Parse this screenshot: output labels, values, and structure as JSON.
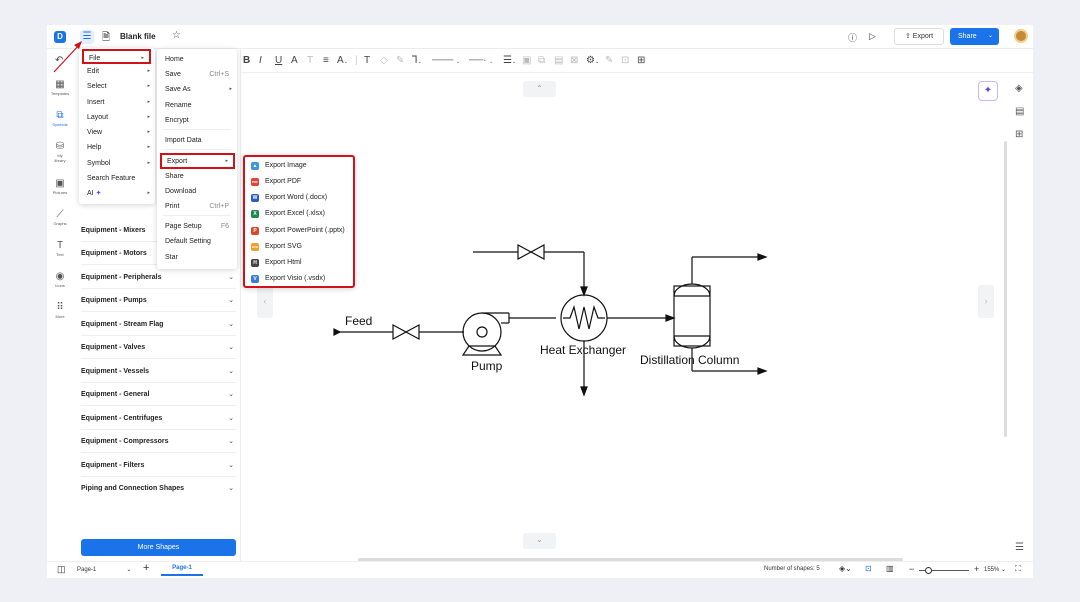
{
  "topbar": {
    "logo_letter": "D",
    "hamburger": "☰",
    "file_title": "Blank file",
    "export_label": "Export",
    "share_label": "Share"
  },
  "rail": [
    {
      "name": "rail-templates",
      "icon": "▦",
      "label": "Templates"
    },
    {
      "name": "rail-symbols",
      "icon": "⧉",
      "label": "Symbols"
    },
    {
      "name": "rail-my-library",
      "icon": "⛁",
      "label": "My library"
    },
    {
      "name": "rail-pictures",
      "icon": "▣",
      "label": "Pictures"
    },
    {
      "name": "rail-graphs",
      "icon": "⟋",
      "label": "Graphs"
    },
    {
      "name": "rail-text",
      "icon": "T",
      "label": "Text"
    },
    {
      "name": "rail-icons",
      "icon": "◉",
      "label": "Icons"
    },
    {
      "name": "rail-more",
      "icon": "⠿",
      "label": "More"
    }
  ],
  "categories": [
    "Equipment - Mixers",
    "Equipment - Motors",
    "Equipment - Peripherals",
    "Equipment - Pumps",
    "Equipment - Stream Flag",
    "Equipment - Valves",
    "Equipment - Vessels",
    "Equipment - General",
    "Equipment - Centrifuges",
    "Equipment - Compressors",
    "Equipment - Filters",
    "Piping and Connection Shapes"
  ],
  "more_shapes": "More Shapes",
  "main_menu": [
    {
      "label": "File",
      "arrow": true
    },
    {
      "label": "Edit",
      "arrow": true
    },
    {
      "label": "Select",
      "arrow": true
    },
    {
      "label": "Insert",
      "arrow": true
    },
    {
      "label": "Layout",
      "arrow": true
    },
    {
      "label": "View",
      "arrow": true
    },
    {
      "label": "Help",
      "arrow": true
    },
    {
      "label": "Symbol",
      "arrow": true
    },
    {
      "label": "Search Feature",
      "arrow": false
    },
    {
      "label": "AI",
      "arrow": true
    }
  ],
  "file_menu": [
    {
      "label": "Home",
      "shortcut": ""
    },
    {
      "label": "Save",
      "shortcut": "Ctrl+S"
    },
    {
      "label": "Save As",
      "shortcut": "▸"
    },
    {
      "label": "Rename",
      "shortcut": ""
    },
    {
      "label": "Encrypt",
      "shortcut": ""
    },
    {
      "label": "Import Data",
      "shortcut": ""
    },
    {
      "label": "Export",
      "shortcut": "▸"
    },
    {
      "label": "Share",
      "shortcut": ""
    },
    {
      "label": "Download",
      "shortcut": ""
    },
    {
      "label": "Print",
      "shortcut": "Ctrl+P"
    },
    {
      "label": "Page Setup",
      "shortcut": "F6"
    },
    {
      "label": "Default Setting",
      "shortcut": ""
    },
    {
      "label": "Star",
      "shortcut": ""
    }
  ],
  "export_menu": [
    {
      "label": "Export Image",
      "badge": "▲",
      "color": "#3a9ad9"
    },
    {
      "label": "Export PDF",
      "badge": "PDF",
      "color": "#e0443a"
    },
    {
      "label": "Export Word (.docx)",
      "badge": "W",
      "color": "#2b5cb8"
    },
    {
      "label": "Export Excel (.xlsx)",
      "badge": "X",
      "color": "#1e8a4a"
    },
    {
      "label": "Export PowerPoint (.pptx)",
      "badge": "P",
      "color": "#d9472b"
    },
    {
      "label": "Export SVG",
      "badge": "SVG",
      "color": "#f0a030"
    },
    {
      "label": "Export Html",
      "badge": "H",
      "color": "#444444"
    },
    {
      "label": "Export Visio (.vsdx)",
      "badge": "V",
      "color": "#3b7bd9"
    }
  ],
  "diagram": {
    "feed": "Feed",
    "pump": "Pump",
    "heat_exchanger": "Heat Exchanger",
    "distillation_column": "Distillation Column"
  },
  "bottom": {
    "page_select": "Page-1",
    "page_tab": "Page-1",
    "shape_count": "Number of shapes: 5",
    "zoom": "155%"
  },
  "colors": {
    "accent": "#1a73e8",
    "highlight": "#d0131b"
  }
}
